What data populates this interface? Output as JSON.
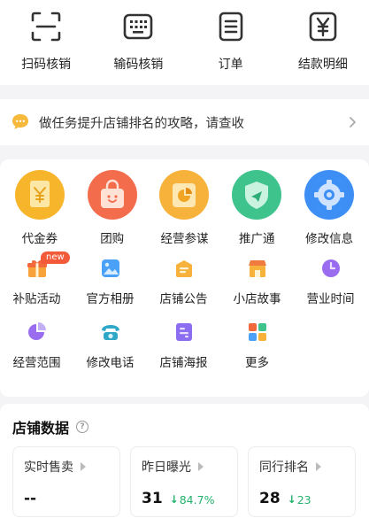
{
  "top_actions": [
    {
      "label": "扫码核销",
      "icon": "scan-icon"
    },
    {
      "label": "输码核销",
      "icon": "keyboard-icon"
    },
    {
      "label": "订单",
      "icon": "order-list-icon"
    },
    {
      "label": "结款明细",
      "icon": "yen-statement-icon"
    }
  ],
  "notice": {
    "text": "做任务提升店铺排名的攻略，请查收",
    "icon": "chat-bubble-icon"
  },
  "main_services": [
    {
      "label": "代金券",
      "icon": "voucher-icon"
    },
    {
      "label": "团购",
      "icon": "shopping-bag-icon"
    },
    {
      "label": "经营参谋",
      "icon": "analytics-icon"
    },
    {
      "label": "推广通",
      "icon": "promotion-icon"
    },
    {
      "label": "修改信息",
      "icon": "settings-gear-icon"
    }
  ],
  "tools": [
    {
      "label": "补贴活动",
      "icon": "gift-icon",
      "badge": "new"
    },
    {
      "label": "官方相册",
      "icon": "photo-album-icon"
    },
    {
      "label": "店铺公告",
      "icon": "announcement-icon"
    },
    {
      "label": "小店故事",
      "icon": "store-story-icon"
    },
    {
      "label": "营业时间",
      "icon": "clock-icon"
    },
    {
      "label": "经营范围",
      "icon": "pie-scope-icon"
    },
    {
      "label": "修改电话",
      "icon": "phone-icon"
    },
    {
      "label": "店铺海报",
      "icon": "poster-icon"
    },
    {
      "label": "更多",
      "icon": "more-grid-icon"
    }
  ],
  "store_data": {
    "title": "店铺数据",
    "help_icon": "question-icon",
    "metrics": [
      {
        "name": "实时售卖",
        "value": "--",
        "change": ""
      },
      {
        "name": "昨日曝光",
        "value": "31",
        "change": "84.7%",
        "direction": "down"
      },
      {
        "name": "同行排名",
        "value": "28",
        "change": "23",
        "direction": "down"
      }
    ]
  },
  "colors": {
    "accent_green": "#23b26d",
    "badge_red": "#f25a3a"
  }
}
